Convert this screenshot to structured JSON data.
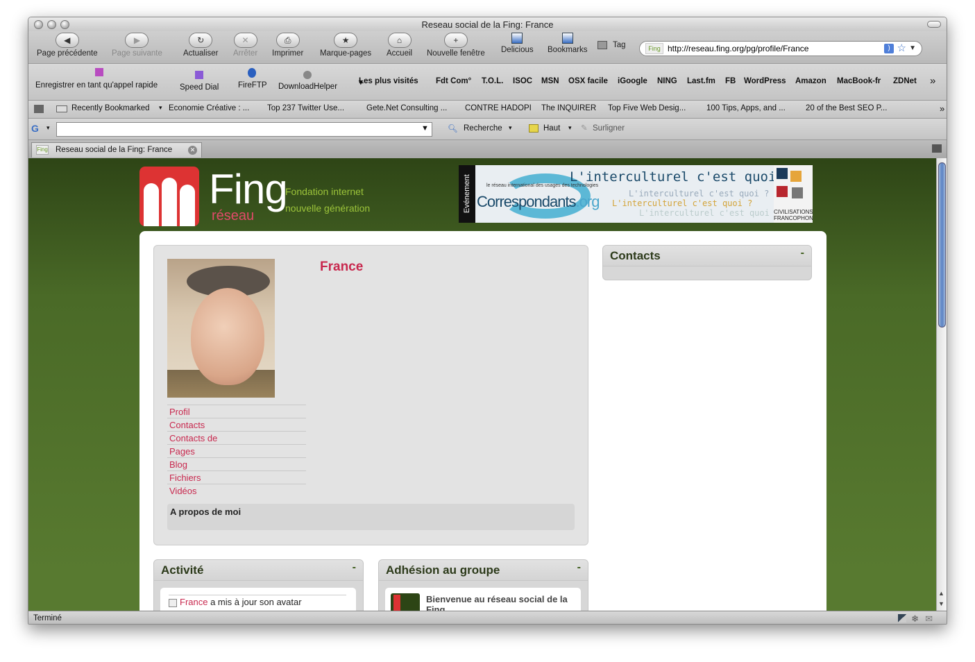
{
  "window": {
    "title": "Reseau social de la Fing: France"
  },
  "toolbar": {
    "back": "Page précédente",
    "forward": "Page suivante",
    "reload": "Actualiser",
    "stop": "Arrêter",
    "print": "Imprimer",
    "bookmarks_menu": "Marque-pages",
    "home": "Accueil",
    "new_window": "Nouvelle fenêtre",
    "delicious": "Delicious",
    "bookmarks": "Bookmarks",
    "tag": "Tag",
    "url": "http://reseau.fing.org/pg/profile/France",
    "favicon": "Fing"
  },
  "bar2": {
    "speed_dial_save": "Enregistrer en tant qu'appel rapide",
    "speed_dial": "Speed Dial",
    "fireftp": "FireFTP",
    "downloadhelper": "DownloadHelper",
    "links": [
      "Les plus visités",
      "Fdt Com°",
      "T.O.L.",
      "ISOC",
      "MSN",
      "OSX facile",
      "iGoogle",
      "NING",
      "Last.fm",
      "FB",
      "WordPress",
      "Amazon",
      "MacBook-fr",
      "ZDNet"
    ],
    "more": "»"
  },
  "bar3": {
    "items": [
      "Recently Bookmarked",
      "Economie Créative : ...",
      "Top 237 Twitter Use...",
      "Gete.Net Consulting ...",
      "CONTRE HADOPI",
      "The INQUIRER",
      "Top Five Web Desig...",
      "100 Tips, Apps, and ...",
      "20 of the Best SEO P..."
    ],
    "more": "»"
  },
  "bar4": {
    "search": "Recherche",
    "top": "Haut",
    "highlight": "Surligner"
  },
  "tab": {
    "title": "Reseau social de la Fing: France",
    "favicon": "Fing"
  },
  "site": {
    "logo": "Fing",
    "logo_sub": "réseau",
    "tagline1": "Fondation internet",
    "tagline2": "nouvelle génération"
  },
  "ad": {
    "event": "Evénement",
    "brand": "Correspondants",
    "brand_tld": ".org",
    "brand_small": "le réseau international des usages des technologies",
    "question": "L'interculturel c'est quoi ?",
    "civ": "CIVILISATIONS FRANCOPHONES"
  },
  "profile": {
    "name": "France",
    "menu": [
      "Profil",
      "Contacts",
      "Contacts de",
      "Pages",
      "Blog",
      "Fichiers",
      "Vidéos"
    ],
    "about": "A propos de moi"
  },
  "contacts": {
    "title": "Contacts",
    "toggle": "-"
  },
  "activity": {
    "title": "Activité",
    "toggle": "-",
    "user": "France",
    "text": " a mis à jour son avatar"
  },
  "group": {
    "title": "Adhésion au groupe",
    "toggle": "-",
    "text": "Bienvenue au réseau social de la Fing"
  },
  "status": "Terminé",
  "colors": {
    "accent": "#c8284e",
    "bg_green": "#4a6a27"
  }
}
